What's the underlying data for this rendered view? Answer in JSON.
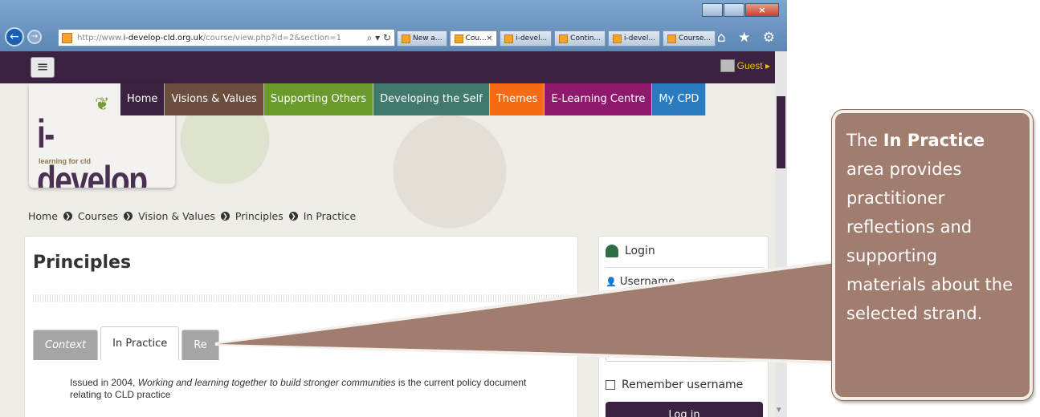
{
  "browser": {
    "url_prefix": "http://www.",
    "url_host": "i-develop-cld.org.uk",
    "url_path": "/course/view.php?id=2&section=1",
    "url_icons": "⌕ ▾ ↻",
    "tabs": [
      "New a...",
      "Cou...",
      "i-devel...",
      "Contin...",
      "i-devel...",
      "Course..."
    ],
    "close_glyph": "×",
    "toolbar_icons": "⌂ ★ ⚙",
    "back_glyph": "←",
    "forward_glyph": "→"
  },
  "site": {
    "menu_glyph": "≡",
    "guest_label": "Guest ▸",
    "logo_text": "i-develop",
    "logo_sub": "learning for cld",
    "nav": [
      {
        "label": "Home",
        "color": "#3a2240"
      },
      {
        "label": "Visions & Values",
        "color": "#6b4e3d"
      },
      {
        "label": "Supporting Others",
        "color": "#6a9b2c"
      },
      {
        "label": "Developing the Self",
        "color": "#3f7a6c"
      },
      {
        "label": "Themes",
        "color": "#f36b12"
      },
      {
        "label": "E-Learning Centre",
        "color": "#8f1a6d"
      },
      {
        "label": "My CPD",
        "color": "#2b7bbf"
      }
    ],
    "breadcrumb": [
      "Home",
      "Courses",
      "Vision & Values",
      "Principles",
      "In Practice"
    ],
    "breadcrumb_sep": "❯",
    "page_title": "Principles",
    "content_tabs": [
      "Context",
      "In Practice",
      "Re"
    ],
    "intro_before": "Issued in 2004, ",
    "intro_italic": "Working and learning together to build stronger communities",
    "intro_after": " is the current policy document relating to CLD practice",
    "login": {
      "heading": "Login",
      "username_label": "Username",
      "remember_label": "Remember username",
      "login_button": "Log in"
    }
  },
  "callout": {
    "prefix": "The ",
    "bold": "In Practice",
    "suffix": " area provides practitioner reflections and supporting materials about the selected strand."
  }
}
